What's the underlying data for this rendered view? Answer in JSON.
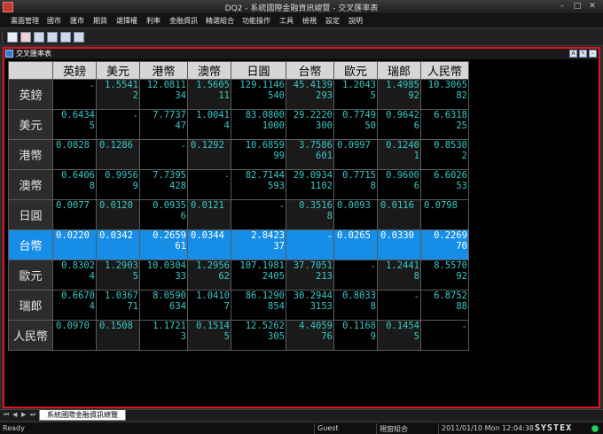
{
  "window": {
    "title": "DQ2 - 系統國際金融資訊總覽 - 交叉匯率表"
  },
  "menu": {
    "items": [
      "畫面管理",
      "國市",
      "匯市",
      "期貨",
      "選擇權",
      "利率",
      "金融資訊",
      "精選組合",
      "功能操作",
      "工具",
      "檢視",
      "設定",
      "說明"
    ]
  },
  "toolbar": {
    "icons": [
      "home-icon",
      "delete-icon",
      "window-icon",
      "layout-icon",
      "tile-icon",
      "split-icon"
    ]
  },
  "panel": {
    "title": "交叉匯率表",
    "buttons": [
      "A",
      "✎",
      "–"
    ]
  },
  "grid": {
    "columns": [
      "英鎊",
      "美元",
      "港幣",
      "澳幣",
      "日圓",
      "台幣",
      "歐元",
      "瑞郎",
      "人民幣"
    ],
    "selected_row": "台幣",
    "rows": [
      {
        "label": "英鎊",
        "values": [
          "-",
          "1.5541\n2",
          "12.0811\n34",
          "1.5605\n11",
          "129.1146\n540",
          "45.4139\n293",
          "1.2043\n5",
          "1.4985\n92",
          "10.3065\n82"
        ]
      },
      {
        "label": "美元",
        "values": [
          "0.6434\n5",
          "-",
          "7.7737\n47",
          "1.0041\n4",
          "83.0800\n1000",
          "29.2220\n300",
          "0.7749\n50",
          "0.9642\n6",
          "6.6318\n25"
        ]
      },
      {
        "label": "港幣",
        "values": [
          "0.0828",
          "0.1286",
          "-",
          "0.1292",
          "10.6859\n99",
          "3.7586\n601",
          "0.0997",
          "0.1240\n1",
          "0.8530\n2"
        ]
      },
      {
        "label": "澳幣",
        "values": [
          "0.6406\n8",
          "0.9956\n9",
          "7.7395\n428",
          "-",
          "82.7144\n593",
          "29.0934\n1102",
          "0.7715\n8",
          "0.9600\n6",
          "6.6026\n53"
        ]
      },
      {
        "label": "日圓",
        "values": [
          "0.0077",
          "0.0120",
          "0.0935\n6",
          "0.0121",
          "-",
          "0.3516\n8",
          "0.0093",
          "0.0116",
          "0.0798"
        ]
      },
      {
        "label": "台幣",
        "values": [
          "0.0220",
          "0.0342",
          "0.2659\n61",
          "0.0344",
          "2.8423\n37",
          "-",
          "0.0265",
          "0.0330",
          "0.2269\n70"
        ]
      },
      {
        "label": "歐元",
        "values": [
          "0.8302\n4",
          "1.2903\n5",
          "10.0304\n33",
          "1.2956\n62",
          "107.1981\n2405",
          "37.7051\n213",
          "-",
          "1.2441\n8",
          "8.5570\n92"
        ]
      },
      {
        "label": "瑞郎",
        "values": [
          "0.6670\n4",
          "1.0367\n71",
          "8.0590\n634",
          "1.0410\n7",
          "86.1290\n854",
          "30.2944\n3153",
          "0.8033\n8",
          "-",
          "6.8752\n88"
        ]
      },
      {
        "label": "人民幣",
        "values": [
          "0.0970",
          "0.1508",
          "1.1721\n3",
          "0.1514\n5",
          "12.5262\n305",
          "4.4059\n76",
          "0.1168\n9",
          "0.1454\n5",
          "-"
        ]
      }
    ]
  },
  "tabs": {
    "nav": [
      "⏮",
      "◀",
      "▶",
      "⏭"
    ],
    "active": "系統國際金融資訊總覽"
  },
  "status": {
    "ready": "Ready",
    "user": "Guest",
    "mode": "視窗組合",
    "datetime": "2011/01/10 Mon 12:04:38",
    "brand": "SYSTEX"
  }
}
